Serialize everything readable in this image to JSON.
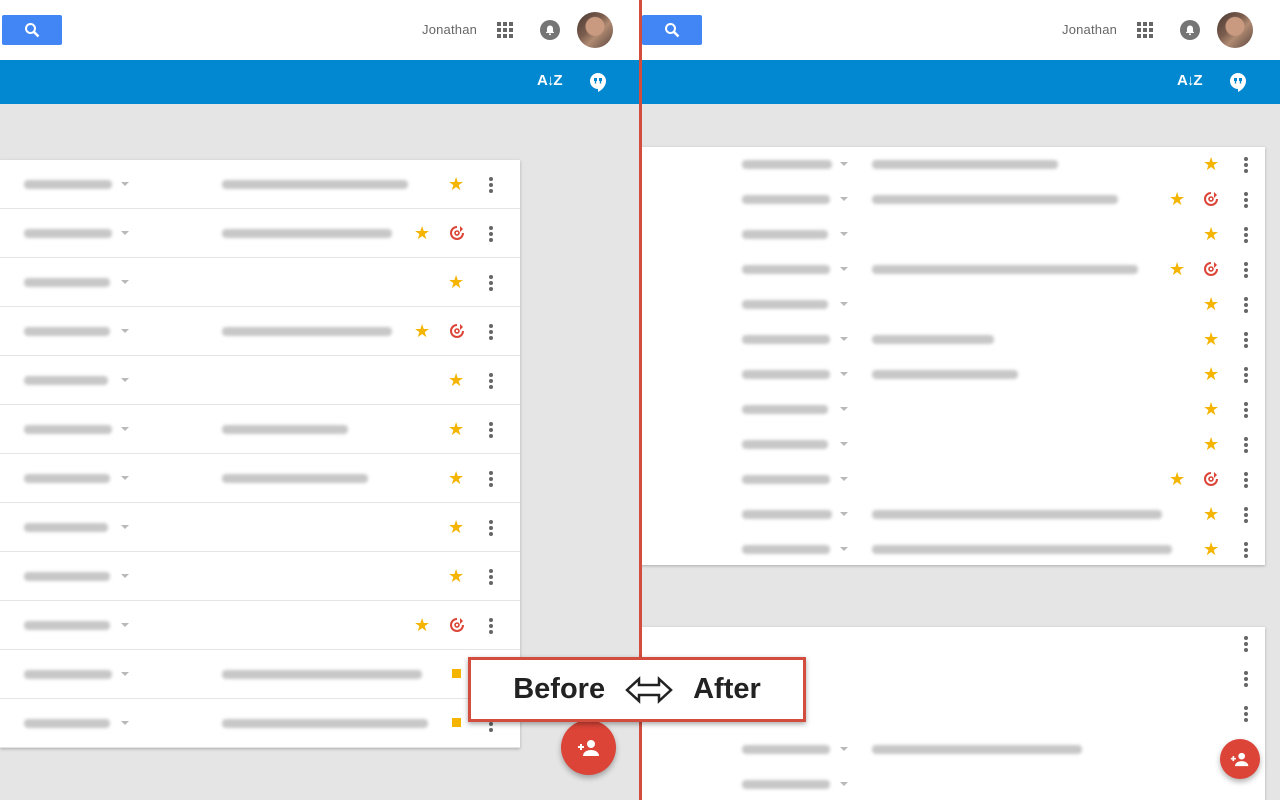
{
  "header": {
    "user_name": "Jonathan"
  },
  "toolbar": {
    "sort_icon": "A↓Z"
  },
  "icons": {
    "search": "search-icon",
    "apps": "apps-grid-icon",
    "notifications": "bell-icon",
    "sort": "sort-az-icon",
    "chat": "hangouts-icon",
    "star": "star-icon",
    "sync": "sync-icon",
    "more": "more-vert-icon",
    "add_contact": "person-add-icon"
  },
  "colors": {
    "blue_bar": "#0288d1",
    "search_button": "#4285f4",
    "star": "#f4b400",
    "fab": "#db4437",
    "divider": "#d24d3e"
  },
  "comparison": {
    "before": "Before",
    "after": "After"
  },
  "before_rows": [
    {
      "starred": true,
      "synced": false
    },
    {
      "starred": true,
      "synced": true
    },
    {
      "starred": true,
      "synced": false
    },
    {
      "starred": true,
      "synced": true
    },
    {
      "starred": true,
      "synced": false
    },
    {
      "starred": true,
      "synced": false
    },
    {
      "starred": true,
      "synced": false
    },
    {
      "starred": true,
      "synced": false
    },
    {
      "starred": true,
      "synced": false
    },
    {
      "starred": true,
      "synced": true
    },
    {
      "starred": true,
      "synced": false
    },
    {
      "starred": true,
      "synced": false
    }
  ],
  "after_rows": [
    {
      "starred": true,
      "synced": false
    },
    {
      "starred": true,
      "synced": true
    },
    {
      "starred": true,
      "synced": false
    },
    {
      "starred": true,
      "synced": true
    },
    {
      "starred": true,
      "synced": false
    },
    {
      "starred": true,
      "synced": false
    },
    {
      "starred": true,
      "synced": false
    },
    {
      "starred": true,
      "synced": false
    },
    {
      "starred": true,
      "synced": false
    },
    {
      "starred": true,
      "synced": true
    },
    {
      "starred": true,
      "synced": false
    },
    {
      "starred": true,
      "synced": false
    }
  ],
  "after_second_card_rows": [
    {
      "starred": false,
      "synced": false
    },
    {
      "starred": false,
      "synced": false
    },
    {
      "starred": false,
      "synced": false
    },
    {
      "starred": false,
      "synced": false
    },
    {
      "starred": false,
      "synced": false
    }
  ]
}
